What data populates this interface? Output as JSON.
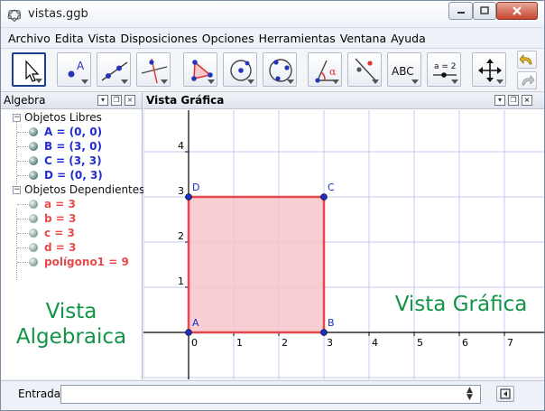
{
  "window": {
    "title": "vistas.ggb"
  },
  "menubar": {
    "items": [
      "Archivo",
      "Edita",
      "Vista",
      "Disposiciones",
      "Opciones",
      "Herramientas",
      "Ventana",
      "Ayuda"
    ]
  },
  "toolbar": {
    "tools": [
      "move-tool",
      "point-tool",
      "line-tool",
      "perpendicular-tool",
      "polygon-tool",
      "circle-center-tool",
      "circle-three-points-tool",
      "angle-tool",
      "reflect-tool",
      "text-tool",
      "slider-tool",
      "move-view-tool"
    ],
    "text_tool_label": "ABC",
    "slider_tool_label": "a = 2",
    "point_tool_label": "A",
    "angle_tool_label": "α"
  },
  "algebra_view": {
    "title": "Algebra",
    "free_group": "Objetos Libres",
    "free_items": [
      "A = (0, 0)",
      "B = (3, 0)",
      "C = (3, 3)",
      "D = (0, 3)"
    ],
    "dependent_group": "Objetos Dependientes",
    "dependent_items": [
      "a = 3",
      "b = 3",
      "c = 3",
      "d = 3",
      "polígono1 = 9"
    ],
    "overlay_label_line1": "Vista",
    "overlay_label_line2": "Algebraica"
  },
  "graphics_view": {
    "title": "Vista Gráfica",
    "overlay_label": "Vista Gráfica",
    "x_ticks": [
      "0",
      "1",
      "2",
      "3",
      "4",
      "5",
      "6",
      "7"
    ],
    "y_ticks": [
      "1",
      "2",
      "3",
      "4"
    ],
    "points": [
      {
        "name": "A",
        "x": 0,
        "y": 0
      },
      {
        "name": "B",
        "x": 3,
        "y": 0
      },
      {
        "name": "C",
        "x": 3,
        "y": 3
      },
      {
        "name": "D",
        "x": 0,
        "y": 3
      }
    ],
    "polygon_fill": "#f7c6ca",
    "polygon_stroke": "#e5474f",
    "point_color": "#1c2fc2",
    "axis_color": "#000000",
    "grid_color": "#c9c9f0"
  },
  "inputbar": {
    "label": "Entrada:",
    "value": "",
    "placeholder": ""
  },
  "colors": {
    "overlay_text": "#119448",
    "free_text": "#1f2fcc",
    "dependent_text": "#e84a4a"
  }
}
